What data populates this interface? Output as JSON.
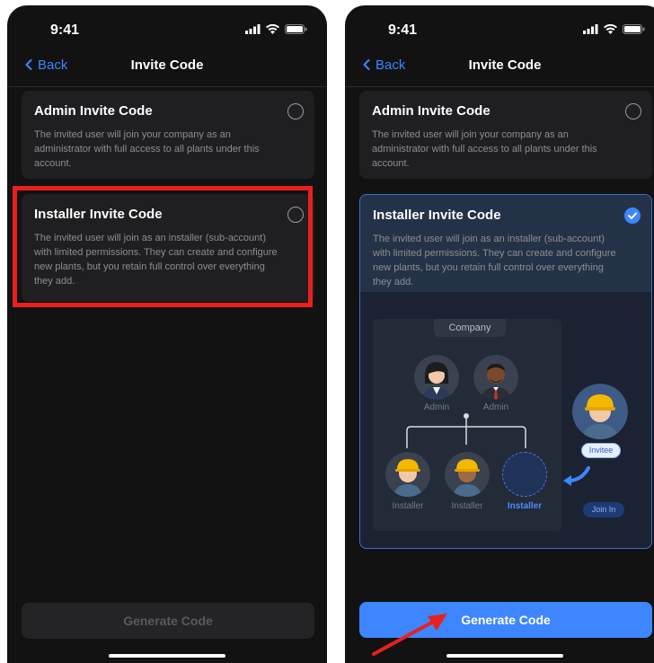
{
  "left_screen": {
    "status": {
      "time": "9:41"
    },
    "nav": {
      "back_label": "Back",
      "title": "Invite Code"
    },
    "options": [
      {
        "title": "Admin Invite Code",
        "description": "The invited user will join your company as an administrator with full access to all plants under this account.",
        "selected": false
      },
      {
        "title": "Installer Invite Code",
        "description": "The invited user will join as an installer (sub-account) with limited permissions. They can create and configure new plants, but you retain full control over everything they add.",
        "selected": false
      }
    ],
    "generate_label": "Generate Code",
    "generate_enabled": false
  },
  "right_screen": {
    "status": {
      "time": "9:41"
    },
    "nav": {
      "back_label": "Back",
      "title": "Invite Code"
    },
    "options": [
      {
        "title": "Admin Invite Code",
        "description": "The invited user will join your company as an administrator with full access to all plants under this account.",
        "selected": false
      },
      {
        "title": "Installer Invite Code",
        "description": "The invited user will join as an installer (sub-account) with limited permissions. They can create and configure new plants, but you retain full control over everything they add.",
        "selected": true
      }
    ],
    "diagram": {
      "company_label": "Company",
      "admin_labels": [
        "Admin",
        "Admin"
      ],
      "installer_labels": [
        "Installer",
        "Installer",
        "Installer"
      ],
      "invitee_label": "Invitee",
      "join_label": "Join In"
    },
    "generate_label": "Generate Code",
    "generate_enabled": true
  },
  "colors": {
    "accent": "#3d86ff",
    "highlight": "#e8201e",
    "background": "#121212",
    "card": "#1f1f21"
  }
}
